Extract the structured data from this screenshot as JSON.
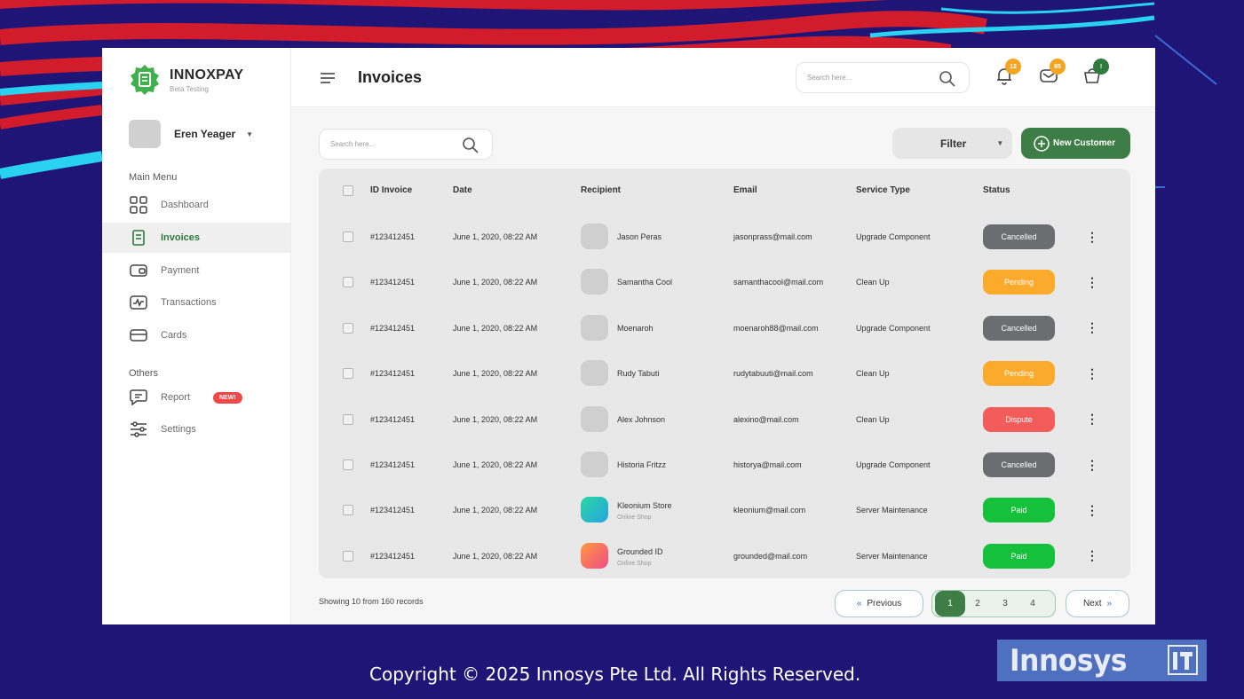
{
  "brand": {
    "name": "INNOXPAY",
    "subtitle": "Beta Testing"
  },
  "profile": {
    "name": "Eren Yeager"
  },
  "sidebar": {
    "main_menu_label": "Main Menu",
    "others_label": "Others",
    "items": [
      {
        "label": "Dashboard",
        "icon": "dashboard-icon"
      },
      {
        "label": "Invoices",
        "icon": "invoice-icon",
        "active": true
      },
      {
        "label": "Payment",
        "icon": "wallet-icon"
      },
      {
        "label": "Transactions",
        "icon": "transactions-icon"
      },
      {
        "label": "Cards",
        "icon": "card-icon"
      }
    ],
    "others": [
      {
        "label": "Report",
        "icon": "report-icon",
        "badge": "NEW!"
      },
      {
        "label": "Settings",
        "icon": "settings-icon"
      }
    ]
  },
  "header": {
    "title": "Invoices",
    "search_placeholder": "Search here...",
    "notifications": {
      "bell": "12",
      "mail": "65",
      "cart": "!"
    }
  },
  "toolbar": {
    "search_placeholder": "Search here...",
    "filter_label": "Filter",
    "new_customer_label": "New Customer"
  },
  "table": {
    "columns": [
      "ID Invoice",
      "Date",
      "Recipient",
      "Email",
      "Service Type",
      "Status"
    ],
    "rows": [
      {
        "id": "#123412451",
        "date": "June 1, 2020, 08:22 AM",
        "recipient": "Jason Peras",
        "sub": "",
        "email": "jasonprass@mail.com",
        "service": "Upgrade Component",
        "status": "Cancelled"
      },
      {
        "id": "#123412451",
        "date": "June 1, 2020, 08:22 AM",
        "recipient": "Samantha Cool",
        "sub": "",
        "email": "samanthacool@mail.com",
        "service": "Clean Up",
        "status": "Pending"
      },
      {
        "id": "#123412451",
        "date": "June 1, 2020, 08:22 AM",
        "recipient": "Moenaroh",
        "sub": "",
        "email": "moenaroh88@mail.com",
        "service": "Upgrade Component",
        "status": "Cancelled"
      },
      {
        "id": "#123412451",
        "date": "June 1, 2020, 08:22 AM",
        "recipient": "Rudy Tabuti",
        "sub": "",
        "email": "rudytabuuti@mail.com",
        "service": "Clean Up",
        "status": "Pending"
      },
      {
        "id": "#123412451",
        "date": "June 1, 2020, 08:22 AM",
        "recipient": "Alex Johnson",
        "sub": "",
        "email": "alexino@mail.com",
        "service": "Clean Up",
        "status": "Dispute"
      },
      {
        "id": "#123412451",
        "date": "June 1, 2020, 08:22 AM",
        "recipient": "Historia Fritzz",
        "sub": "",
        "email": "historya@mail.com",
        "service": "Upgrade Component",
        "status": "Cancelled"
      },
      {
        "id": "#123412451",
        "date": "June 1, 2020, 08:22 AM",
        "recipient": "Kleonium Store",
        "sub": "Online Shop",
        "email": "kleonium@mail.com",
        "service": "Server Maintenance",
        "status": "Paid"
      },
      {
        "id": "#123412451",
        "date": "June 1, 2020, 08:22 AM",
        "recipient": "Grounded ID",
        "sub": "Online Shop",
        "email": "grounded@mail.com",
        "service": "Server Maintenance",
        "status": "Paid"
      }
    ]
  },
  "status_colors": {
    "Cancelled": "#6b6d70",
    "Pending": "#fbaa2b",
    "Dispute": "#f45b5b",
    "Paid": "#15c13a"
  },
  "avatar_styles": [
    "gray",
    "gray",
    "gray",
    "gray",
    "gray",
    "gray",
    "teal-gradient",
    "orange-gradient"
  ],
  "pagination": {
    "summary": "Showing 10 from 160 records",
    "previous_label": "Previous",
    "next_label": "Next",
    "pages": [
      "1",
      "2",
      "3",
      "4"
    ],
    "current": "1"
  },
  "footer": {
    "copyright": "Copyright © 2025 Innosys Pte Ltd. All Rights Reserved.",
    "logo_text": "Innosys"
  },
  "colors": {
    "accent": "#3e7d46",
    "background": "#1e1577"
  }
}
